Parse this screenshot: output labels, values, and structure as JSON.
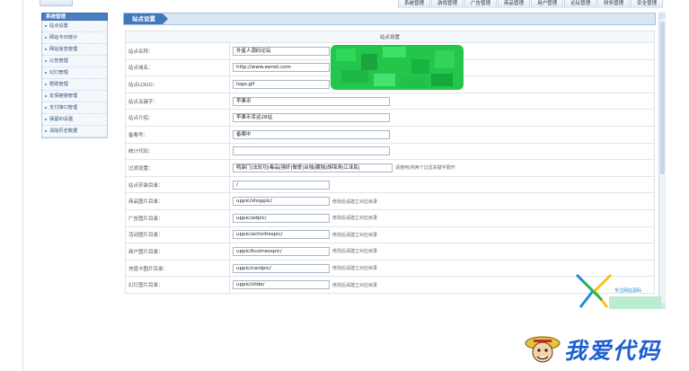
{
  "topnav": [
    "系统管理",
    "游戏管理",
    "广告管理",
    "商品管理",
    "用户管理",
    "论坛管理",
    "财务管理",
    "安全管理"
  ],
  "sidebar": {
    "title": "系统管理",
    "items": [
      "站点设置",
      "网站今日统计",
      "网站信息管理",
      "公告管理",
      "幻灯管理",
      "帮助管理",
      "友情链接管理",
      "支付接口管理",
      "保留ID设置",
      "清除历史数据"
    ]
  },
  "main": {
    "header": "站点设置",
    "caption": "站点设置",
    "rows": [
      {
        "label": "站点名称：",
        "value": "外星人源码论坛",
        "hint": ""
      },
      {
        "label": "站点域名：",
        "value": "http://www.eenot.com",
        "hint": ""
      },
      {
        "label": "站点LOGO：",
        "value": "logo.gif",
        "hint": ""
      },
      {
        "label": "站点关键字：",
        "value": "苹果币",
        "hint": ""
      },
      {
        "label": "站点介绍：",
        "value": "苹果币幸运28站",
        "hint": ""
      },
      {
        "label": "备案号：",
        "value": "备案中",
        "hint": ""
      },
      {
        "label": "统计代码：",
        "value": "",
        "hint": ""
      },
      {
        "label": "过滤设置：",
        "value": "鸭屎门|法轮功|毒品|强奸|做爱|台独|藏独|胡锦涛|江泽民|",
        "hint": "请使用|将两个过滤关键字隔开"
      },
      {
        "label": "站点安装目录：",
        "value": "/",
        "hint": ""
      },
      {
        "label": "商品图片目录：",
        "value": "uppic/shoppic/",
        "hint": "修改后请建立对应目录"
      },
      {
        "label": "广告图片目录：",
        "value": "uppic/adpic/",
        "hint": "修改后请建立对应目录"
      },
      {
        "label": "活动图片目录：",
        "value": "uppic/activitiespic/",
        "hint": "修改后请建立对应目录"
      },
      {
        "label": "商户图片目录：",
        "value": "uppic/businesspic/",
        "hint": "修改后请建立对应目录"
      },
      {
        "label": "充值卡图片目录：",
        "value": "uppic/cardpic/",
        "hint": "修改后请建立对应目录"
      },
      {
        "label": "幻灯图片目录：",
        "value": "uppic/slide/",
        "hint": "修改后请建立对应目录"
      }
    ]
  },
  "corner_logo_text": "专注网站源码",
  "watermark": "我爱代码",
  "colors": {
    "accent": "#3f78bd",
    "header_bg": "#d9e6f4",
    "blur_green": "#23c64a",
    "watermark": "#1d5fd0"
  }
}
